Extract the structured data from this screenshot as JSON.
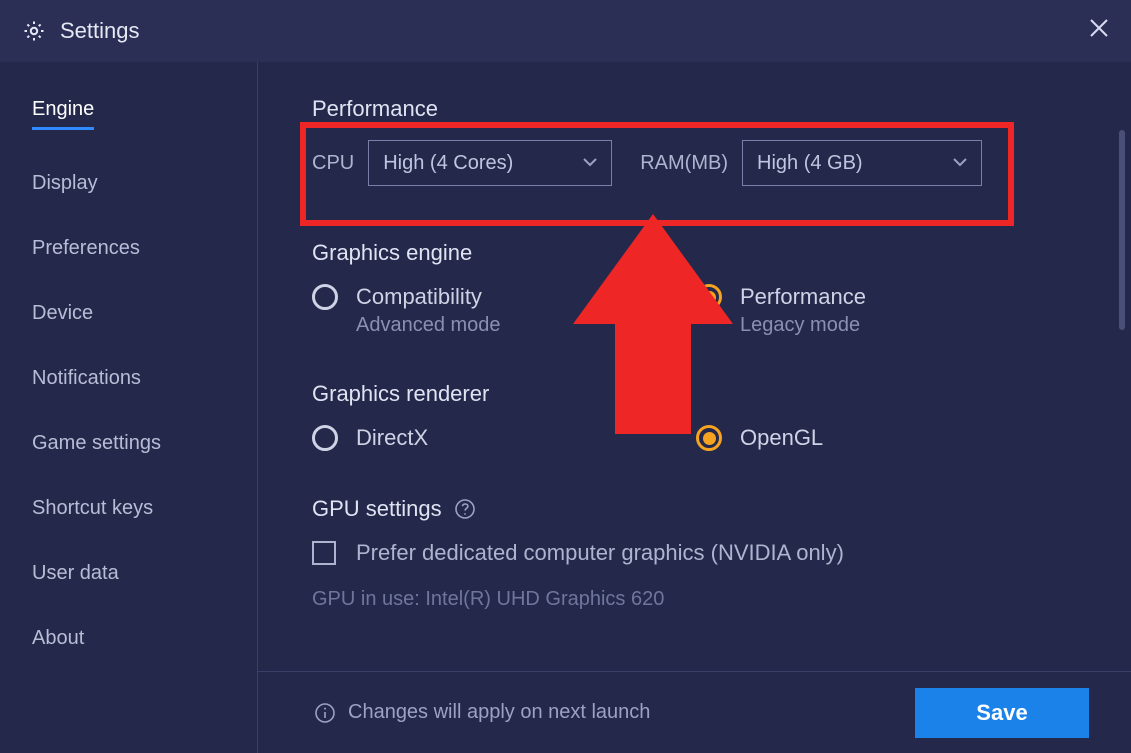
{
  "title": "Settings",
  "sidebar": {
    "items": [
      {
        "label": "Engine",
        "active": true
      },
      {
        "label": "Display"
      },
      {
        "label": "Preferences"
      },
      {
        "label": "Device"
      },
      {
        "label": "Notifications"
      },
      {
        "label": "Game settings"
      },
      {
        "label": "Shortcut keys"
      },
      {
        "label": "User data"
      },
      {
        "label": "About"
      }
    ]
  },
  "performance": {
    "heading": "Performance",
    "cpu_label": "CPU",
    "cpu_value": "High (4 Cores)",
    "ram_label": "RAM(MB)",
    "ram_value": "High (4 GB)"
  },
  "graphics_engine": {
    "heading": "Graphics engine",
    "options": [
      {
        "label": "Compatibility",
        "sub": "Advanced mode",
        "selected": false
      },
      {
        "label": "Performance",
        "sub": "Legacy mode",
        "selected": true
      }
    ]
  },
  "graphics_renderer": {
    "heading": "Graphics renderer",
    "options": [
      {
        "label": "DirectX",
        "selected": false
      },
      {
        "label": "OpenGL",
        "selected": true
      }
    ]
  },
  "gpu_settings": {
    "heading": "GPU settings",
    "checkbox_label": "Prefer dedicated computer graphics (NVIDIA only)",
    "gpu_in_use": "GPU in use: Intel(R) UHD Graphics 620"
  },
  "footer": {
    "note": "Changes will apply on next launch",
    "save_label": "Save"
  },
  "colors": {
    "accent": "#1a82e8",
    "highlight": "#ee2626",
    "radio_selected": "#f5a321"
  }
}
